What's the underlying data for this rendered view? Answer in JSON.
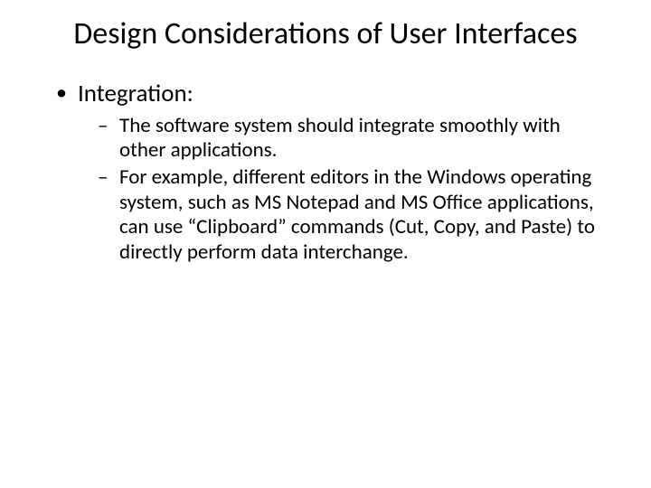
{
  "title": "Design Considerations of User Interfaces",
  "bullets": [
    {
      "label": "Integration:",
      "sub": [
        "The software system should integrate smoothly with other applications.",
        "For example, different editors in the Windows operating system, such as MS Notepad and MS Office applications, can use “Clipboard” commands (Cut, Copy, and Paste) to directly perform data interchange."
      ]
    }
  ]
}
